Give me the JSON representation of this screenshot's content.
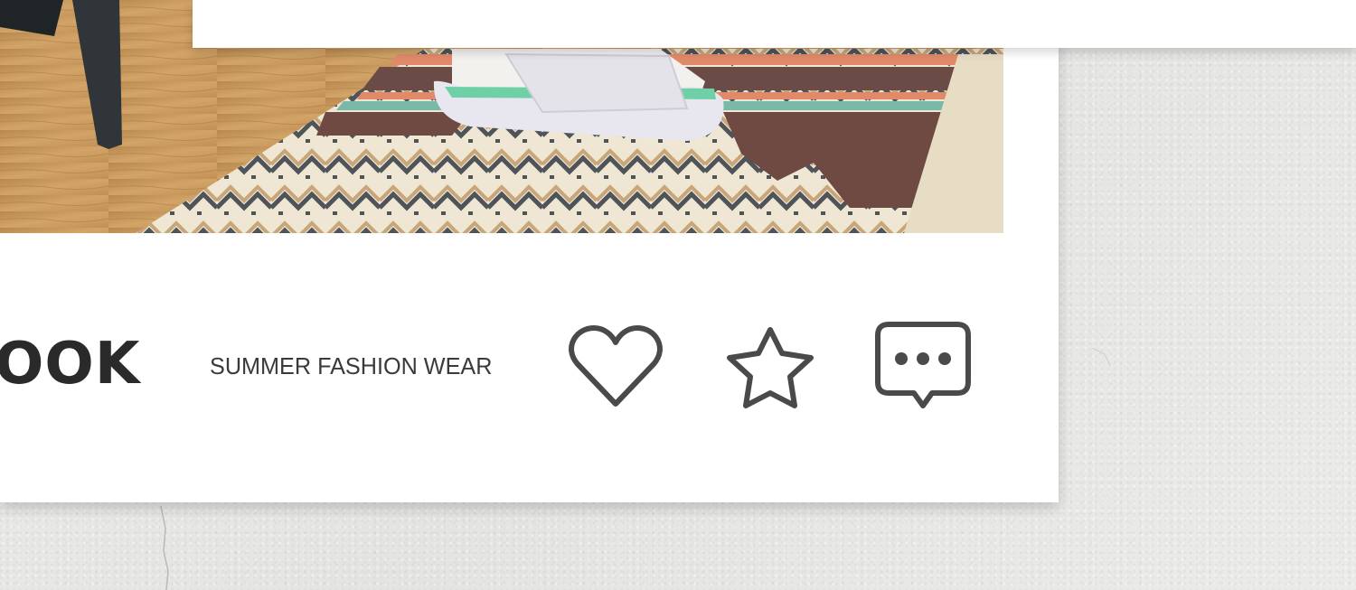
{
  "post": {
    "brand_fragment": "OOK",
    "tagline": "SUMMER FASHION WEAR",
    "image_alt": "slide sandal on patterned rug"
  },
  "actions": {
    "like_icon": "heart-icon",
    "favorite_icon": "star-icon",
    "comment_icon": "chat-bubble-icon"
  },
  "colors": {
    "icon_stroke": "#4a4a4a",
    "brand_text": "#2a2a2a",
    "card_bg": "#ffffff",
    "wall_bg": "#e9e9e7"
  }
}
